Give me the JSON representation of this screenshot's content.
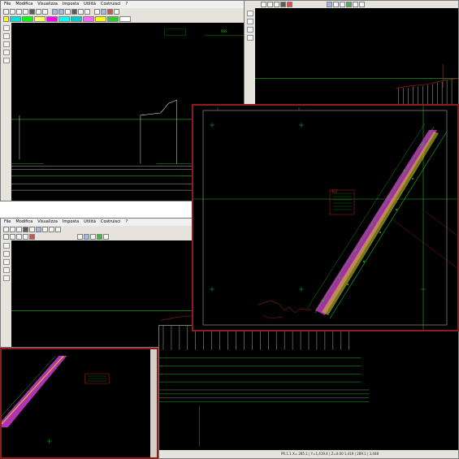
{
  "menu": {
    "file": "File",
    "modifica": "Modifica",
    "visualizza": "Visualizza",
    "imposta": "Imposta",
    "utilita": "Utilità",
    "costruzione": "Costruisci",
    "help": "?"
  },
  "cad_labels": {
    "rhs_value": "RHS",
    "legend_block": "SEZ"
  },
  "statusbar": {
    "text": "PR.1.1    X= 285.1 | Y=1,419.4 | Z=0.00    1,419 | 289.1 | 3,448"
  },
  "colors": {
    "canvas_bg": "#000000",
    "axis_green": "#1fb31f",
    "road_magenta": "#d23ad2",
    "road_yellow": "#c8c820",
    "frame_red": "#8b1d1d",
    "ground_white": "#e0e0e0"
  }
}
